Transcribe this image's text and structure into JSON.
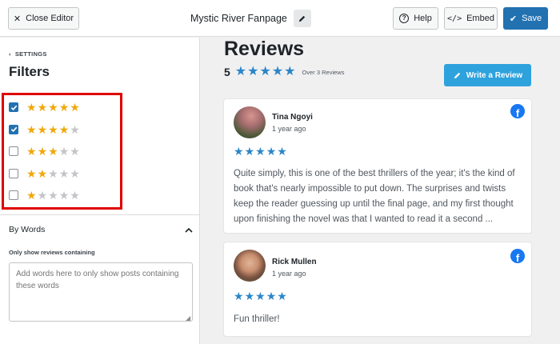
{
  "topbar": {
    "close_label": "Close Editor",
    "title": "Mystic River Fanpage",
    "help_label": "Help",
    "embed_label": "Embed",
    "save_label": "Save"
  },
  "sidebar": {
    "back_label": "SETTINGS",
    "title": "Filters",
    "filters": [
      {
        "stars": 5,
        "checked": true
      },
      {
        "stars": 4,
        "checked": true
      },
      {
        "stars": 3,
        "checked": false
      },
      {
        "stars": 2,
        "checked": false
      },
      {
        "stars": 1,
        "checked": false
      }
    ],
    "section_title": "By Words",
    "field_label": "Only show reviews containing",
    "textarea_placeholder": "Add words here to only show posts containing these words"
  },
  "preview": {
    "heading": "Reviews",
    "rating": "5",
    "review_count": "Over 3 Reviews",
    "write_label": "Write a Review",
    "reviews": [
      {
        "name": "Tina Ngoyi",
        "time": "1 year ago",
        "stars": 5,
        "text": "Quite simply, this is one of the best thrillers of the year; it's the kind of book that's nearly impossible to put down. The surprises and twists keep the reader guessing up until the final page, and my first thought upon finishing the novel was that I wanted to read it a second ..."
      },
      {
        "name": "Rick Mullen",
        "time": "1 year ago",
        "stars": 5,
        "text": "Fun thriller!"
      }
    ]
  },
  "colors": {
    "accent": "#2271b1",
    "star_gold": "#f0a80c",
    "star_blue": "#2a86c8",
    "highlight": "#e00000",
    "facebook": "#1877f2"
  }
}
